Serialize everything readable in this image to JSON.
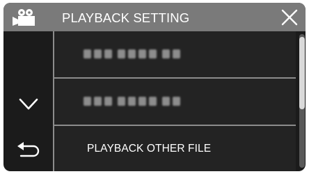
{
  "header": {
    "title": "PLAYBACK SETTING",
    "mode_icon": "video-camera-icon",
    "close_icon": "close-icon"
  },
  "nav": {
    "down_icon": "chevron-down-icon",
    "back_icon": "return-arrow-icon"
  },
  "items": [
    {
      "label": "",
      "blurred": true
    },
    {
      "label": "",
      "blurred": true
    },
    {
      "label": "PLAYBACK OTHER FILE",
      "blurred": false
    }
  ],
  "scrollbar": {
    "thumb_fraction": 0.55,
    "position": 0
  },
  "colors": {
    "header_bg": "#7a7a7a",
    "screen_bg": "#1b1b1b",
    "item_bg": "#232323",
    "divider": "#8c8c8c",
    "text": "#ffffff"
  }
}
